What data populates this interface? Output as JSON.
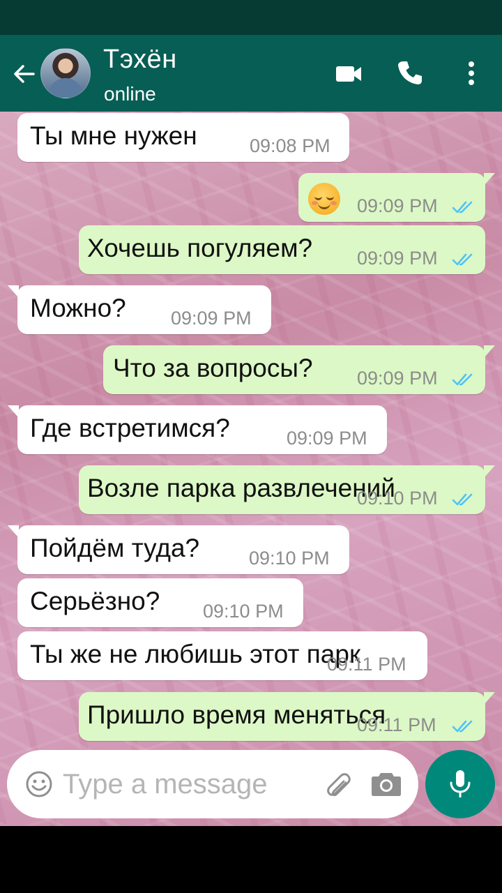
{
  "header": {
    "contact_name": "Тэхён",
    "contact_status": "online"
  },
  "messages": [
    {
      "dir": "in",
      "text": "Ты мне нужен",
      "time": "09:08 PM",
      "ticks": false,
      "tail": false
    },
    {
      "dir": "out",
      "text": "☺️",
      "time": "09:09 PM",
      "ticks": true,
      "tail": true,
      "emoji": true
    },
    {
      "dir": "out",
      "text": "Хочешь погуляем?",
      "time": "09:09 PM",
      "ticks": true,
      "tail": false
    },
    {
      "dir": "in",
      "text": "Можно?",
      "time": "09:09 PM",
      "ticks": false,
      "tail": true
    },
    {
      "dir": "out",
      "text": "Что за вопросы?",
      "time": "09:09 PM",
      "ticks": true,
      "tail": true
    },
    {
      "dir": "in",
      "text": "Где встретимся?",
      "time": "09:09 PM",
      "ticks": false,
      "tail": true
    },
    {
      "dir": "out",
      "text": "Возле парка развлечений",
      "time": "09:10 PM",
      "ticks": true,
      "tail": true
    },
    {
      "dir": "in",
      "text": "Пойдём туда?",
      "time": "09:10 PM",
      "ticks": false,
      "tail": true
    },
    {
      "dir": "in",
      "text": "Серьёзно?",
      "time": "09:10 PM",
      "ticks": false,
      "tail": false
    },
    {
      "dir": "in",
      "text": "Ты же не любишь этот парк",
      "time": "09:11 PM",
      "ticks": false,
      "tail": false
    },
    {
      "dir": "out",
      "text": "Пришло время меняться",
      "time": "09:11 PM",
      "ticks": true,
      "tail": true
    }
  ],
  "input": {
    "placeholder": "Type a message",
    "value": ""
  },
  "colors": {
    "header": "#075e54",
    "status_bar": "#053b33",
    "outgoing_bubble": "#dcf8c6",
    "incoming_bubble": "#ffffff",
    "read_ticks": "#4fc3f7",
    "mic_button": "#00897b"
  },
  "icons": {
    "back": "back-arrow-icon",
    "video": "video-call-icon",
    "call": "phone-icon",
    "menu": "more-vert-icon",
    "emoji": "emoji-icon",
    "attach": "paperclip-icon",
    "camera": "camera-icon",
    "mic": "mic-icon"
  }
}
